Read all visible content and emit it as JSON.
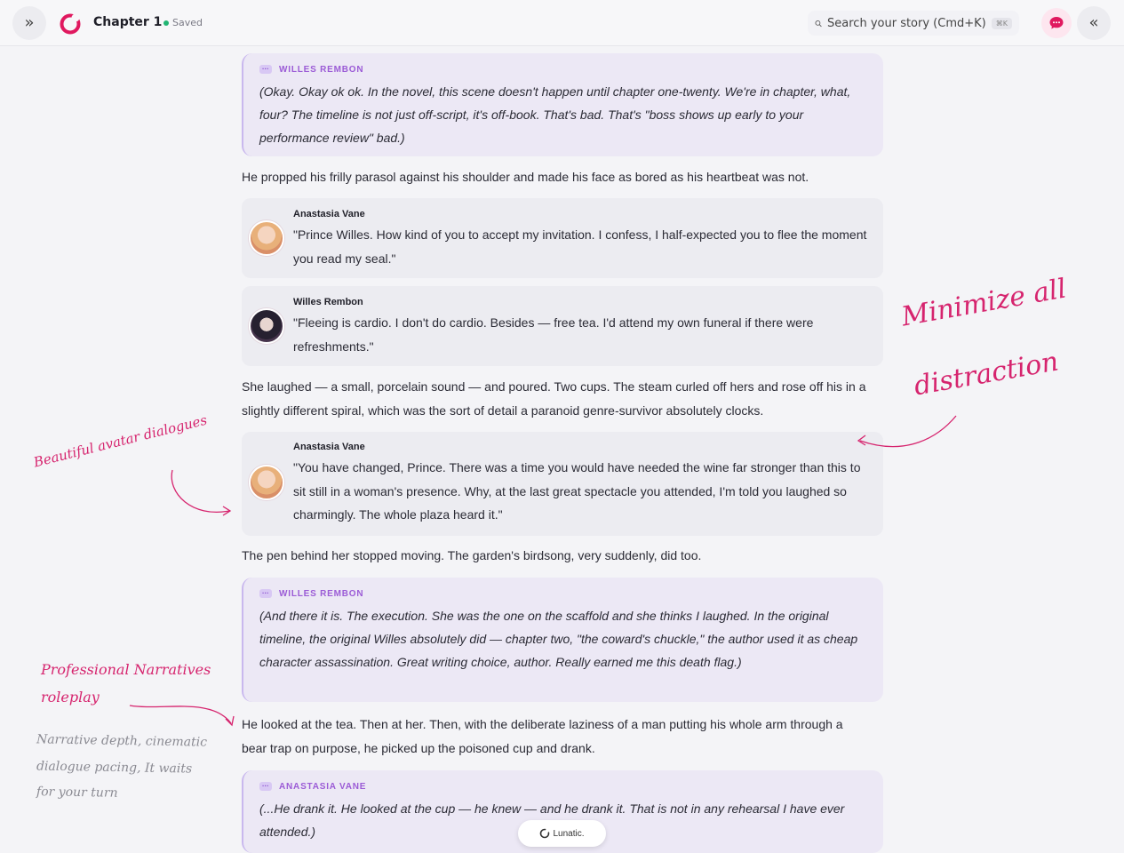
{
  "header": {
    "chapter_title": "Chapter 1",
    "save_status": "Saved",
    "search_placeholder": "Search your story (Cmd+K)",
    "search_shortcut": "⌘K",
    "icons": [
      "chevrons-right-icon",
      "brand-logo-icon",
      "search-icon",
      "chat-bubble-icon",
      "chevrons-left-icon"
    ]
  },
  "story": {
    "aside1": {
      "speaker": "WILLES REMBON",
      "text": "(Okay. Okay ok ok. In the novel, this scene doesn't happen until chapter one-twenty. We're in chapter, what, four? The timeline is not just off-script, it's off-book. That's bad. That's \"boss shows up early to your performance review\" bad.)"
    },
    "para1": "He propped his frilly parasol against his shoulder and made his face as bored as his heartbeat was not.",
    "dialogue1": {
      "speaker": "Anastasia Vane",
      "text": "\"Prince Willes. How kind of you to accept my invitation. I confess, I half-expected you to flee the moment you read my seal.\""
    },
    "dialogue2": {
      "speaker": "Willes Rembon",
      "text": "\"Fleeing is cardio. I don't do cardio. Besides — free tea. I'd attend my own funeral if there were refreshments.\""
    },
    "para2": "She laughed — a small, porcelain sound — and poured. Two cups. The steam curled off hers and rose off his in a slightly different spiral, which was the sort of detail a paranoid genre-survivor absolutely clocks.",
    "dialogue3": {
      "speaker": "Anastasia Vane",
      "text": "\"You have changed, Prince. There was a time you would have needed the wine far stronger than this to sit still in a woman's presence. Why, at the last great spectacle you attended, I'm told you laughed so charmingly. The whole plaza heard it.\""
    },
    "para3": "The pen behind her stopped moving. The garden's birdsong, very suddenly, did too.",
    "aside2": {
      "speaker": "WILLES REMBON",
      "text": "(And there it is. The execution. She was the one on the scaffold and she thinks I laughed. In the original timeline, the original Willes absolutely did — chapter two, \"the coward's chuckle,\" the author used it as cheap character assassination. Great writing choice, author. Really earned me this death flag.)"
    },
    "para4": "He looked at the tea. Then at her. Then, with the deliberate laziness of a man putting his whole arm through a bear trap on purpose, he picked up the poisoned cup and drank.",
    "aside3": {
      "speaker": "ANASTASIA VANE",
      "text": "(...He drank it. He looked at the cup — he knew — and he drank it. That is not in any rehearsal I have ever attended.)"
    }
  },
  "annotations": {
    "minimize_line1": "Minimize all",
    "minimize_line2": "distraction",
    "avatar_dialogues": "Beautiful avatar dialogues",
    "professional_line1": "Professional Narratives",
    "professional_line2": "roleplay",
    "gray_line1": "Narrative depth, cinematic",
    "gray_line2": "dialogue pacing, It waits",
    "gray_line3": "for your turn"
  },
  "badge": {
    "label": "Lunatic."
  },
  "colors": {
    "accent": "#e0195f",
    "annotation": "#d6246e",
    "aside_label": "#9b5bd6",
    "aside_bg": "#ece8f5",
    "saved_dot": "#22b573"
  }
}
